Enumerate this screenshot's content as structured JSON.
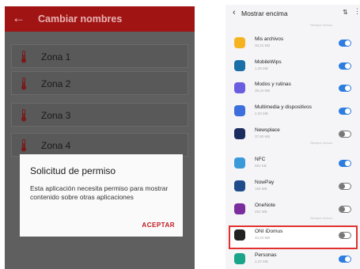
{
  "left_screen": {
    "title": "Cambiar nombres",
    "back_icon": "arrow-left-icon",
    "zones": [
      "Zona 1",
      "Zona 2",
      "Zona 3",
      "Zona 4"
    ],
    "dialog": {
      "title": "Solicitud de permiso",
      "message": "Esta aplicación necesita permiso para mostrar contenido sobre otras aplicaciones",
      "accept": "ACEPTAR"
    },
    "colors": {
      "appbar": "#a01414",
      "accept": "#c0161c"
    }
  },
  "right_screen": {
    "title": "Mostrar encima",
    "sublabel": "Siempre incluso",
    "apps": [
      {
        "name": "Mis archivos",
        "size": "30,22 MB",
        "enabled": true,
        "color": "#f5b41f"
      },
      {
        "name": "MobileWips",
        "size": "1,38 MB",
        "enabled": true,
        "color": "#1a6fa8"
      },
      {
        "name": "Modos y rutinas",
        "size": "39,44 MB",
        "enabled": true,
        "color": "#6b5de0"
      },
      {
        "name": "Multimedia y dispositivos",
        "size": "2,03 MB",
        "enabled": true,
        "color": "#3c6edc"
      },
      {
        "name": "Newsplace",
        "size": "37,80 MB",
        "enabled": false,
        "color": "#1b2c5e"
      },
      {
        "name": "NFC",
        "size": "691 KB",
        "enabled": true,
        "color": "#3a9ad9"
      },
      {
        "name": "NowPay",
        "size": "168 MB",
        "enabled": false,
        "color": "#1f4a8c"
      },
      {
        "name": "OneNote",
        "size": "282 MB",
        "enabled": false,
        "color": "#7a2e9e"
      },
      {
        "name": "ONI iDomus",
        "size": "40,63 MB",
        "enabled": false,
        "color": "#222222"
      },
      {
        "name": "Personas",
        "size": "2,22 MB",
        "enabled": true,
        "color": "#1aa48a"
      }
    ],
    "highlight_color": "#e0312f",
    "toggle_on_color": "#2d7de0"
  }
}
